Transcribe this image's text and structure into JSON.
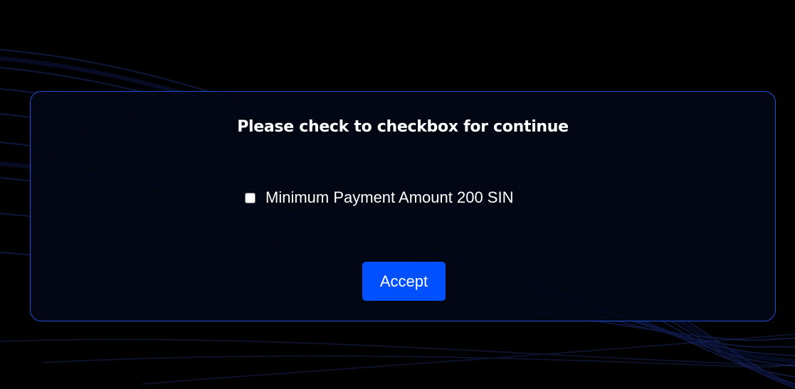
{
  "modal": {
    "title": "Please check to checkbox for continue",
    "checkbox": {
      "label": "Minimum Payment Amount 200 SIN",
      "checked": false
    },
    "accept_label": "Accept"
  },
  "colors": {
    "background": "#000000",
    "modal_border": "#1f4fd6",
    "button": "#0050ff",
    "text": "#ffffff"
  }
}
